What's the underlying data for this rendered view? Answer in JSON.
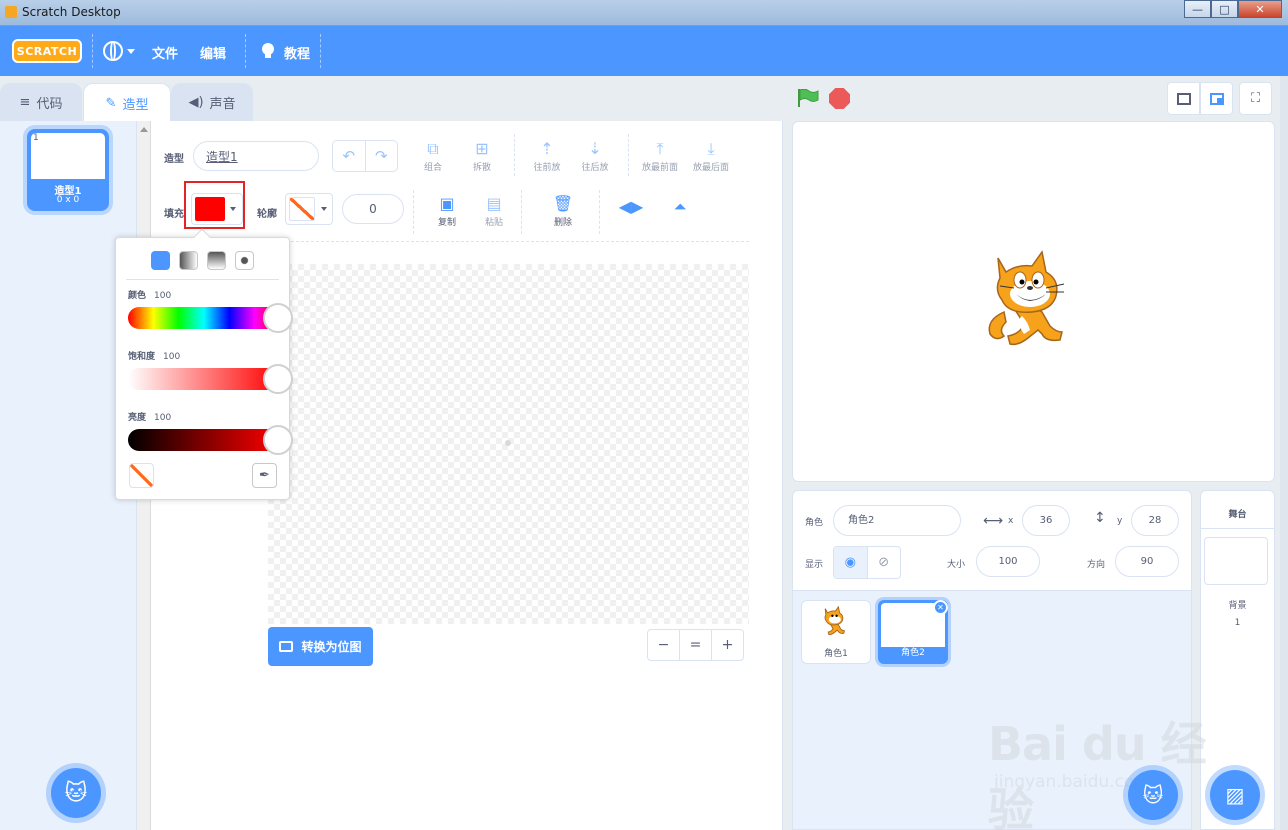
{
  "window": {
    "title": "Scratch Desktop",
    "minimize": "—",
    "maximize": "□",
    "close": "✕"
  },
  "menubar": {
    "logo": "SCRATCH",
    "file": "文件",
    "edit": "编辑",
    "tutorials": "教程"
  },
  "tabs": [
    {
      "label": "代码",
      "icon": "code-icon"
    },
    {
      "label": "造型",
      "icon": "brush-icon"
    },
    {
      "label": "声音",
      "icon": "speaker-icon"
    }
  ],
  "costumes": [
    {
      "number": "1",
      "name": "造型1",
      "size": "0 x 0"
    }
  ],
  "paint_editor": {
    "costume_label": "造型",
    "costume_name": "造型1",
    "fill_label": "填充",
    "outline_label": "轮廓",
    "outline_width": "0",
    "fill_color": "#ff0000",
    "outline_color": "#ff6a1a",
    "tools": {
      "group": "组合",
      "ungroup": "拆散",
      "forward": "往前放",
      "backward": "往后放",
      "front": "放最前面",
      "back": "放最后面",
      "copy": "复制",
      "paste": "粘贴",
      "delete": "删除"
    },
    "convert_label": "转换为位图",
    "zoom_out": "−",
    "zoom_reset": "=",
    "zoom_in": "+"
  },
  "color_popover": {
    "hue_label": "颜色",
    "hue_value": "100",
    "saturation_label": "饱和度",
    "saturation_value": "100",
    "brightness_label": "亮度",
    "brightness_value": "100",
    "hue_level": 1.0,
    "saturation_level": 1.0,
    "brightness_level": 1.0
  },
  "sprite_info": {
    "sprite_label": "角色",
    "sprite_name": "角色2",
    "x_label": "x",
    "x_value": "36",
    "y_label": "y",
    "y_value": "28",
    "show_label": "显示",
    "size_label": "大小",
    "size_value": "100",
    "direction_label": "方向",
    "direction_value": "90"
  },
  "sprites": [
    {
      "name": "角色1",
      "selected": false
    },
    {
      "name": "角色2",
      "selected": true
    }
  ],
  "stage_pane": {
    "title": "舞台",
    "backdrops_label": "背景",
    "backdrops_count": "1"
  },
  "watermark": {
    "main": "Bai du 经验",
    "sub": "jingyan.baidu.com"
  },
  "colors": {
    "accent": "#4c97ff",
    "logo": "#ffab19",
    "stop": "#ec5959",
    "flag": "#4cbf56"
  }
}
